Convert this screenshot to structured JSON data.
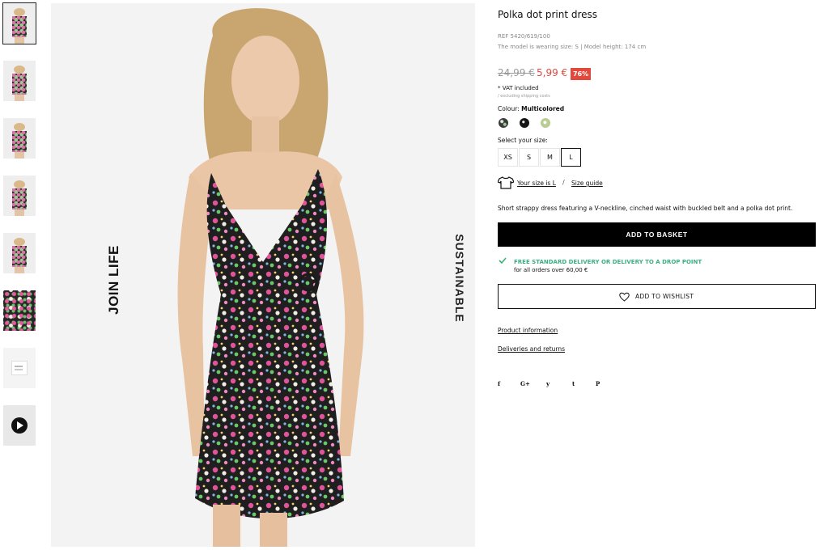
{
  "gallery": {
    "thumbnails": [
      {
        "kind": "model",
        "active": true
      },
      {
        "kind": "model-side"
      },
      {
        "kind": "model-back"
      },
      {
        "kind": "model-full"
      },
      {
        "kind": "model-crop"
      },
      {
        "kind": "fabric-closeup"
      },
      {
        "kind": "label-tag"
      },
      {
        "kind": "video",
        "icon": "play-icon"
      }
    ],
    "main_left_text": "JOIN LIFE",
    "main_right_text": "SUSTAINABLE"
  },
  "product": {
    "title": "Polka dot print dress",
    "ref": "REF 5420/619/100",
    "model_note": "The model is wearing size: S | Model height: 174 cm",
    "old_price": "24,99 €",
    "new_price": "5,99 €",
    "discount": "76%",
    "vat": "* VAT included",
    "shipping_note": "/ excluding shipping costs",
    "colour_label": "Colour:",
    "colour_value": "Multicolored",
    "colours": [
      {
        "name": "multicolored-floral",
        "color": "#3b3b3b"
      },
      {
        "name": "black-dot",
        "color": "#161616"
      },
      {
        "name": "green-dot",
        "color": "#b8cc94"
      }
    ],
    "size_label": "Select your size:",
    "sizes": [
      "XS",
      "S",
      "M",
      "L"
    ],
    "selected_size": "L",
    "your_size": "Your size is L",
    "separator": "/",
    "size_guide": "Size guide",
    "description": "Short strappy dress featuring a V-neckline, cinched waist with buckled belt and a polka dot print.",
    "add_to_basket": "ADD TO BASKET",
    "delivery_title": "FREE STANDARD DELIVERY OR DELIVERY TO A DROP POINT",
    "delivery_sub": "for all orders over 60,00 €",
    "add_to_wishlist": "ADD TO WISHLIST",
    "product_info_link": "Product information",
    "deliveries_link": "Deliveries and returns"
  },
  "social": [
    {
      "icon": "facebook-icon",
      "glyph": "f"
    },
    {
      "icon": "google-plus-icon",
      "glyph": "G+"
    },
    {
      "icon": "twitter-icon",
      "glyph": "y"
    },
    {
      "icon": "tumblr-icon",
      "glyph": "t"
    },
    {
      "icon": "pinterest-icon",
      "glyph": "P"
    }
  ],
  "colors": {
    "accent_red": "#e2483c",
    "delivery_green": "#3cb07f",
    "button_black": "#000000"
  }
}
